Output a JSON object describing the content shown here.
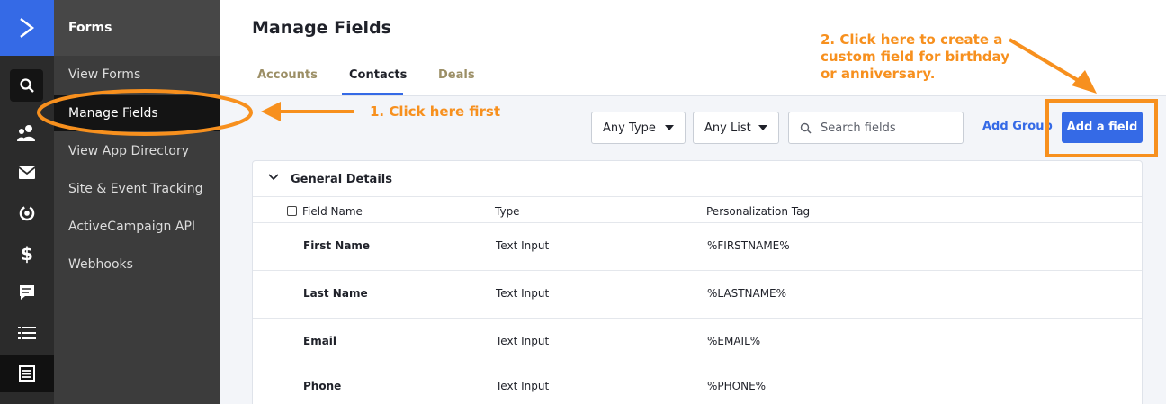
{
  "rail": {
    "icons": [
      "activecampaign-logo-icon",
      "search-icon",
      "contacts-icon",
      "email-icon",
      "automation-icon",
      "dollar-icon",
      "conversations-icon",
      "list-icon",
      "forms-icon"
    ]
  },
  "nav": {
    "header": "Forms",
    "items": [
      {
        "label": "View Forms"
      },
      {
        "label": "Manage Fields"
      },
      {
        "label": "View App Directory"
      },
      {
        "label": "Site & Event Tracking"
      },
      {
        "label": "ActiveCampaign API"
      },
      {
        "label": "Webhooks"
      }
    ],
    "active_item": "Manage Fields"
  },
  "page": {
    "title": "Manage Fields",
    "tabs": [
      {
        "label": "Accounts"
      },
      {
        "label": "Contacts"
      },
      {
        "label": "Deals"
      }
    ],
    "active_tab": "Contacts"
  },
  "toolbar": {
    "type_select": "Any Type",
    "list_select": "Any List",
    "search_placeholder": "Search fields",
    "add_group": "Add Group",
    "add_field": "Add a field"
  },
  "group": {
    "title": "General Details",
    "columns": [
      "Field Name",
      "Type",
      "Personalization Tag"
    ],
    "rows": [
      {
        "name": "First Name",
        "type": "Text Input",
        "tag": "%FIRSTNAME%"
      },
      {
        "name": "Last Name",
        "type": "Text Input",
        "tag": "%LASTNAME%"
      },
      {
        "name": "Email",
        "type": "Text Input",
        "tag": "%EMAIL%"
      },
      {
        "name": "Phone",
        "type": "Text Input",
        "tag": "%PHONE%"
      }
    ]
  },
  "annotations": {
    "step1": "1. Click here first",
    "step2_line1": "2. Click here to create a",
    "step2_line2": "custom field for birthday",
    "step2_line3": "or anniversary.",
    "color": "#f7901e"
  },
  "colors": {
    "accent": "#356ae6",
    "rail_bg": "#2b2b2b",
    "nav_bg": "#3c3c3c"
  }
}
